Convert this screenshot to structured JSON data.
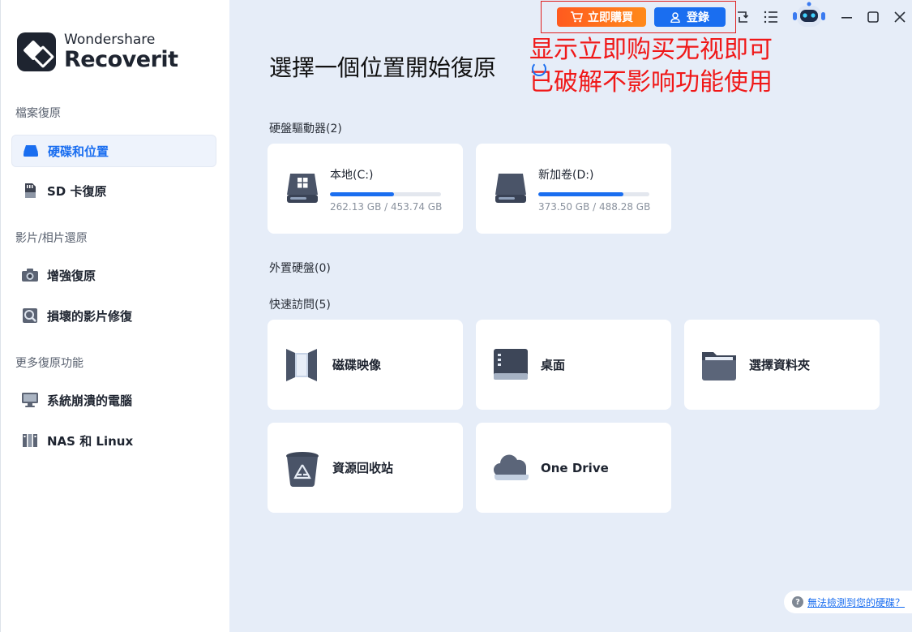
{
  "app": {
    "brand_line1": "Wondershare",
    "brand_line2": "Recoverit"
  },
  "sidebar": {
    "sections": [
      {
        "title": "檔案復原"
      },
      {
        "title": "影片/相片還原"
      },
      {
        "title": "更多復原功能"
      }
    ],
    "items": [
      {
        "label": "硬碟和位置",
        "icon": "drive-icon",
        "active": true
      },
      {
        "label": "SD 卡復原",
        "icon": "sd-card-icon"
      },
      {
        "label": "增強復原",
        "icon": "camera-icon"
      },
      {
        "label": "損壞的影片修復",
        "icon": "video-repair-icon"
      },
      {
        "label": "系統崩潰的電腦",
        "icon": "monitor-icon"
      },
      {
        "label": "NAS 和 Linux",
        "icon": "nas-icon"
      }
    ]
  },
  "topbar": {
    "buy_label": "立即購買",
    "login_label": "登錄",
    "icons": [
      "sync-icon",
      "menu-list-icon",
      "robot-avatar-icon",
      "minimize-icon",
      "maximize-icon",
      "close-icon"
    ]
  },
  "annotation": {
    "line1": "显示立即购买无视即可",
    "line2": "已破解不影响功能使用",
    "color": "#f01818"
  },
  "main": {
    "heading": "選擇一個位置開始復原",
    "hard_drives": {
      "label": "硬盤驅動器(2)",
      "items": [
        {
          "name": "本地(C:)",
          "size": "262.13 GB / 453.74 GB",
          "used_fraction": 0.578,
          "icon": "windows-drive-icon"
        },
        {
          "name": "新加卷(D:)",
          "size": "373.50 GB / 488.28 GB",
          "used_fraction": 0.765,
          "icon": "hard-drive-icon"
        }
      ]
    },
    "external_drives": {
      "label": "外置硬盤(0)"
    },
    "quick_access": {
      "label": "快速訪問(5)",
      "items": [
        {
          "name": "磁碟映像",
          "icon": "disk-image-icon"
        },
        {
          "name": "桌面",
          "icon": "desktop-icon"
        },
        {
          "name": "選擇資料夾",
          "icon": "folder-icon"
        },
        {
          "name": "資源回收站",
          "icon": "recycle-bin-icon"
        },
        {
          "name": "One Drive",
          "icon": "onedrive-cloud-icon"
        }
      ]
    },
    "help_link": "無法檢測到您的硬碟？"
  },
  "colors": {
    "accent": "#1a6ef0",
    "buy_gradient_start": "#ff5a1f",
    "buy_gradient_end": "#ff8a1a",
    "main_bg": "#e6edf8"
  }
}
